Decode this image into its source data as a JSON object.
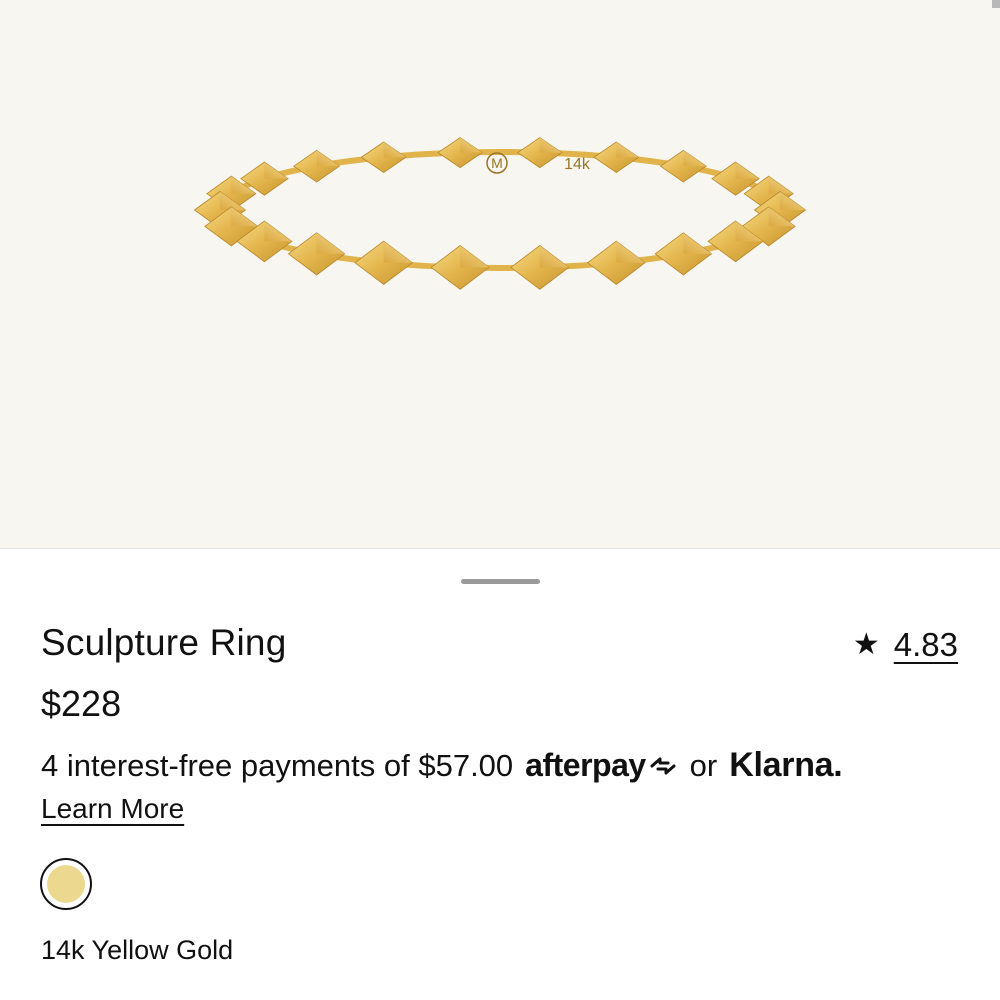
{
  "product": {
    "name": "Sculpture Ring",
    "price": "$228",
    "rating_star": "★",
    "rating": "4.83",
    "ring_stamps": [
      "M",
      "14k"
    ]
  },
  "payment": {
    "text": "4 interest-free payments of $57.00",
    "afterpay_label": "afterpay",
    "or_label": "or",
    "klarna_label": "Klarna.",
    "learn_more": "Learn More"
  },
  "variant": {
    "selected_metal": "14k Yellow Gold",
    "swatch_color": "#ecd88f"
  },
  "colors": {
    "hero_background": "#f8f6f1",
    "gold": "#e0b44a"
  }
}
